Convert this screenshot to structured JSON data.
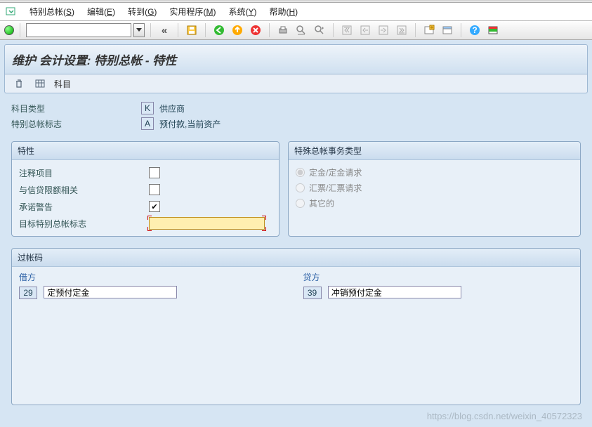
{
  "menu": {
    "items": [
      {
        "label": "特别总帐",
        "key": "S"
      },
      {
        "label": "编辑",
        "key": "E"
      },
      {
        "label": "转到",
        "key": "G"
      },
      {
        "label": "实用程序",
        "key": "M"
      },
      {
        "label": "系统",
        "key": "Y"
      },
      {
        "label": "帮助",
        "key": "H"
      }
    ]
  },
  "toolbar": {
    "command_value": "",
    "back_symbol": "«"
  },
  "page_title": "维护 会计设置: 特别总帐 - 特性",
  "subtoolbar": {
    "accounts_label": "科目"
  },
  "header": {
    "account_type_label": "科目类型",
    "account_type_code": "K",
    "account_type_text": "供应商",
    "sgl_indicator_label": "特别总帐标志",
    "sgl_indicator_code": "A",
    "sgl_indicator_text": "预付款,当前资产"
  },
  "properties_panel": {
    "title": "特性",
    "rows": {
      "noted_items": {
        "label": "注释项目",
        "checked": false
      },
      "credit_limit": {
        "label": "与信贷限额相关",
        "checked": false
      },
      "commitment_warning": {
        "label": "承诺警告",
        "checked": true
      },
      "target_sgl": {
        "label": "目标特别总帐标志",
        "value": ""
      }
    }
  },
  "txn_type_panel": {
    "title": "特殊总帐事务类型",
    "options": {
      "down_payment": {
        "label": "定金/定金请求",
        "selected": true
      },
      "bill_exchange": {
        "label": "汇票/汇票请求",
        "selected": false
      },
      "others": {
        "label": "其它的",
        "selected": false
      }
    }
  },
  "posting_panel": {
    "title": "过帐码",
    "debit": {
      "title": "借方",
      "code": "29",
      "text": "定预付定金"
    },
    "credit": {
      "title": "贷方",
      "code": "39",
      "text": "冲销预付定金"
    }
  },
  "watermark": "https://blog.csdn.net/weixin_40572323"
}
